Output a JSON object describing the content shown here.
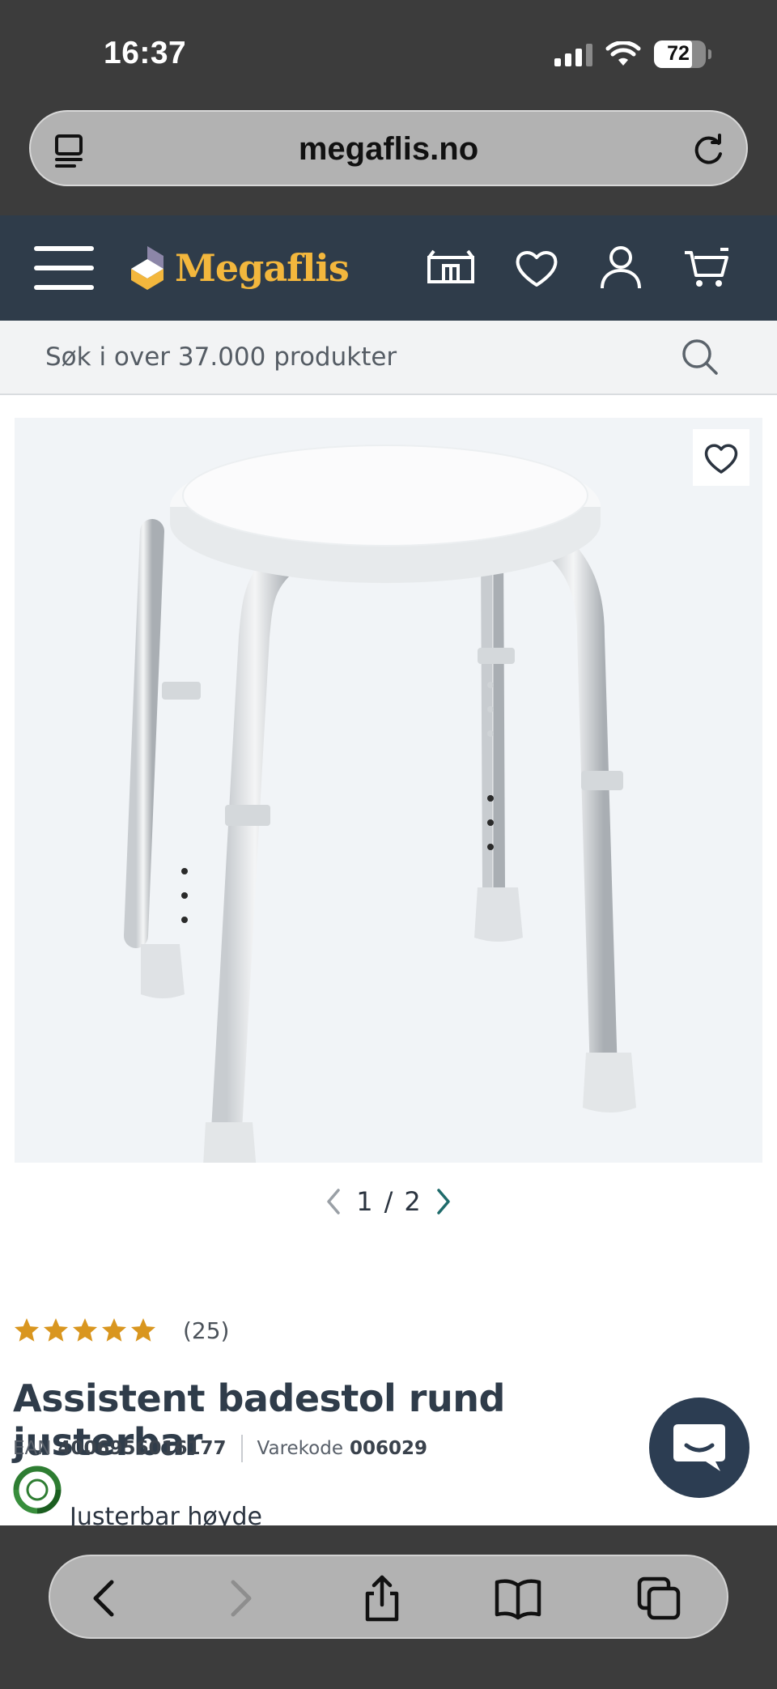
{
  "status_bar": {
    "time": "16:37",
    "battery": "72"
  },
  "browser": {
    "url": "megaflis.no"
  },
  "header": {
    "brand": "Megaflis"
  },
  "search": {
    "placeholder": "Søk i over 37.000 produkter"
  },
  "gallery": {
    "current": "1",
    "separator": "/",
    "total": "2"
  },
  "product": {
    "rating": 5,
    "review_count": "(25)",
    "title": "Assistent badestol rund justerbar",
    "ean_label": "EAN",
    "ean": "4006956016177",
    "code_label": "Varekode",
    "code": "006029",
    "feature": "Justerbar høyde"
  },
  "colors": {
    "header_bg": "#2f3c4a",
    "brand_yellow": "#f3b73d",
    "star": "#d9961f",
    "accent_teal": "#1f6b6b"
  }
}
